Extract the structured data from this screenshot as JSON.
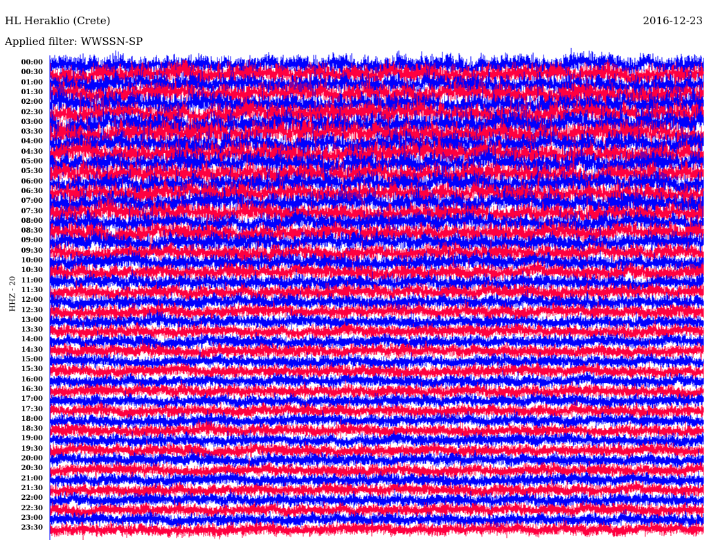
{
  "header": {
    "station": "HL Heraklio (Crete)",
    "date": "2016-12-23",
    "filter": "Applied filter: WWSSN-SP",
    "channel": "HHZ - 20"
  },
  "chart_data": {
    "type": "line",
    "title": "HL Heraklio (Crete)",
    "subtitle": "Applied filter: WWSSN-SP",
    "ylabel": "HHZ - 20",
    "row_labels": [
      "00:00",
      "00:30",
      "01:00",
      "01:30",
      "02:00",
      "02:30",
      "03:00",
      "03:30",
      "04:00",
      "04:30",
      "05:00",
      "05:30",
      "06:00",
      "06:30",
      "07:00",
      "07:30",
      "08:00",
      "08:30",
      "09:00",
      "09:30",
      "10:00",
      "10:30",
      "11:00",
      "11:30",
      "12:00",
      "12:30",
      "13:00",
      "13:30",
      "14:00",
      "14:30",
      "15:00",
      "15:30",
      "16:00",
      "16:30",
      "17:00",
      "17:30",
      "18:00",
      "18:30",
      "19:00",
      "19:30",
      "20:00",
      "20:30",
      "21:00",
      "21:30",
      "22:00",
      "22:30",
      "23:00",
      "23:30"
    ],
    "relative_amplitude": [
      1.0,
      1.0,
      1.0,
      1.05,
      1.1,
      1.1,
      1.15,
      1.15,
      1.1,
      1.1,
      1.1,
      1.05,
      1.0,
      1.0,
      1.0,
      0.95,
      0.9,
      0.9,
      0.85,
      0.8,
      0.8,
      0.75,
      0.72,
      0.7,
      0.68,
      0.65,
      0.62,
      0.6,
      0.6,
      0.6,
      0.58,
      0.58,
      0.58,
      0.58,
      0.58,
      0.58,
      0.58,
      0.58,
      0.58,
      0.58,
      0.58,
      0.58,
      0.58,
      0.58,
      0.58,
      0.58,
      0.58,
      0.58
    ],
    "colors": [
      "#0000ff",
      "#ff0040"
    ]
  }
}
